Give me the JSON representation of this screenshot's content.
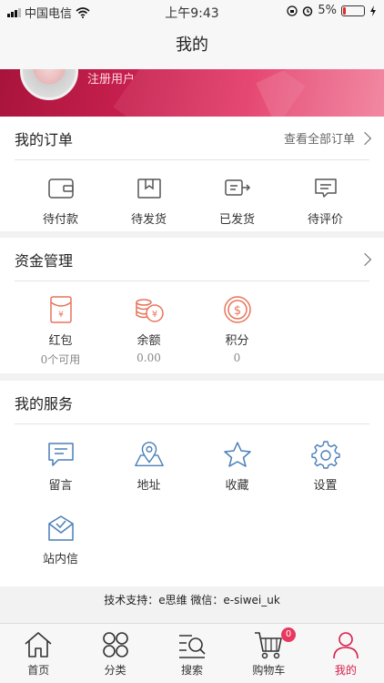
{
  "status_bar": {
    "carrier": "中国电信",
    "time": "上午9:43",
    "battery_percent": "5%"
  },
  "nav": {
    "title": "我的"
  },
  "profile": {
    "user_label": "注册用户"
  },
  "orders": {
    "title": "我的订单",
    "view_all": "查看全部订单",
    "items": [
      {
        "label": "待付款",
        "icon": "wallet-icon"
      },
      {
        "label": "待发货",
        "icon": "package-icon"
      },
      {
        "label": "已发货",
        "icon": "truck-icon"
      },
      {
        "label": "待评价",
        "icon": "comment-icon"
      }
    ]
  },
  "funds": {
    "title": "资金管理",
    "items": [
      {
        "label": "红包",
        "value": "0个可用",
        "icon": "red-envelope-icon"
      },
      {
        "label": "余额",
        "value": "0.00",
        "icon": "coins-icon"
      },
      {
        "label": "积分",
        "value": "0",
        "icon": "points-icon"
      }
    ]
  },
  "services": {
    "title": "我的服务",
    "items": [
      {
        "label": "留言",
        "icon": "message-icon"
      },
      {
        "label": "地址",
        "icon": "map-icon"
      },
      {
        "label": "收藏",
        "icon": "star-icon"
      },
      {
        "label": "设置",
        "icon": "gear-icon"
      },
      {
        "label": "站内信",
        "icon": "mail-icon"
      }
    ]
  },
  "support_text": "技术支持：e思维 微信：e-siwei_uk",
  "tabbar": {
    "items": [
      {
        "label": "首页",
        "icon": "home-icon"
      },
      {
        "label": "分类",
        "icon": "category-icon"
      },
      {
        "label": "搜索",
        "icon": "search-icon"
      },
      {
        "label": "购物车",
        "icon": "cart-icon",
        "badge": "0"
      },
      {
        "label": "我的",
        "icon": "user-icon",
        "active": true
      }
    ]
  },
  "colors": {
    "accent": "#d81e4a",
    "icon_blue": "#4a7fb8",
    "icon_coral": "#e8735a"
  }
}
